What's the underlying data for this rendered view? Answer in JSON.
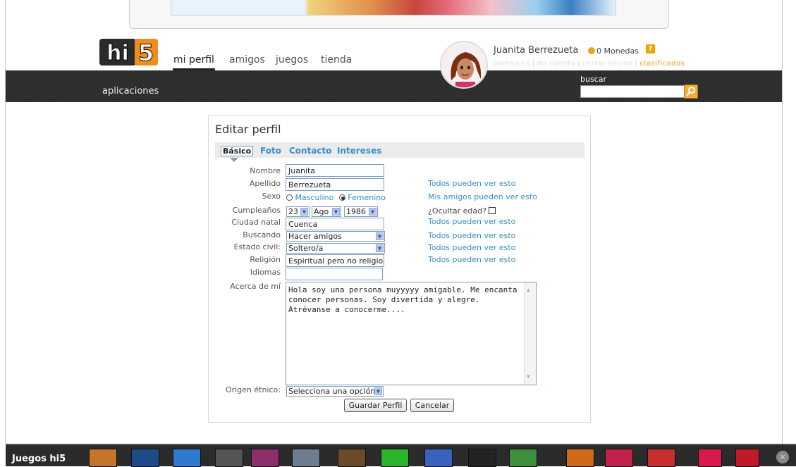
{
  "header": {
    "logo_text": "hi5",
    "nav": [
      "mi perfil",
      "amigos",
      "juegos",
      "tienda"
    ],
    "apps_label": "aplicaciones",
    "user_name": "Juanita Berrezueta",
    "coins": "0 Monedas",
    "help": "?",
    "links": [
      "mensajes",
      "mi cuenta",
      "cerrar sesión",
      "clasificados"
    ],
    "search_label": "buscar"
  },
  "form": {
    "title": "Editar perfil",
    "tabs": [
      "Básico",
      "Foto",
      "Contacto",
      "Intereses"
    ],
    "labels": {
      "nombre": "Nombre",
      "apellido": "Apellido",
      "sexo": "Sexo",
      "cumple": "Cumpleaños",
      "ciudad": "Ciudad natal",
      "buscando": "Buscando",
      "estado": "Estado civil:",
      "religion": "Religión",
      "idiomas": "Idiomas",
      "acerca": "Acerca de mí",
      "origen": "Origen étnico:"
    },
    "values": {
      "nombre": "Juanita",
      "apellido": "Berrezueta",
      "sexo_m": "Masculino",
      "sexo_f": "Femenino",
      "dia": "23",
      "mes": "Ago",
      "anio": "1986",
      "ciudad": "Cuenca",
      "buscando": "Hacer amigos",
      "estado": "Soltero/a",
      "religion": "Espiritual pero no religioso",
      "idiomas": "",
      "acerca": "Hola soy una persona muyyyyy amigable. Me encanta conocer personas. Soy divertida y alegre. Atrévanse a conocerme....",
      "origen": "Selecciona una opción"
    },
    "privacy": {
      "apellido": "Todos pueden ver esto",
      "sexo": "Mis amigos pueden ver esto",
      "ocultar": "¿Ocultar edad?",
      "ciudad": "Todos pueden ver esto",
      "buscando": "Todos pueden ver esto",
      "estado": "Todos pueden ver esto",
      "religion": "Todos pueden ver esto"
    },
    "buttons": {
      "save": "Guardar Perfil",
      "cancel": "Cancelar"
    }
  },
  "bottom": {
    "title": "Juegos hi5",
    "game_colors": [
      "#c4752a",
      "#1d4c8a",
      "#2f7ad0",
      "#555555",
      "#8e2e6a",
      "#6c7f91",
      "#6b4a2a",
      "#2ab52a",
      "#3a60c0",
      "#222222",
      "#3f8f3f",
      "#d06a1a",
      "#c0224a",
      "#c83030",
      "#d81a4a",
      "#c01a2a"
    ],
    "close": "×"
  }
}
